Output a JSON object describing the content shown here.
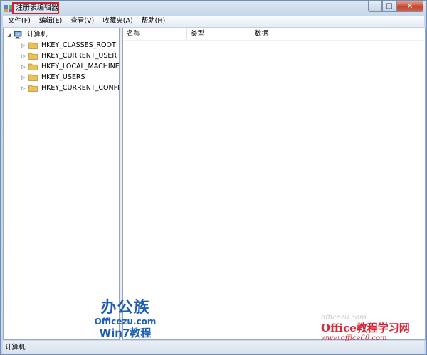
{
  "window": {
    "title": "注册表编辑器",
    "caption_buttons": {
      "minimize": "–",
      "maximize": "□",
      "close": "✕"
    }
  },
  "menu": {
    "items": [
      "文件(F)",
      "编辑(E)",
      "查看(V)",
      "收藏夹(A)",
      "帮助(H)"
    ]
  },
  "tree": {
    "root": {
      "label": "计算机",
      "expander": "◢",
      "icon": "computer-icon"
    },
    "children": [
      {
        "label": "HKEY_CLASSES_ROOT",
        "expander": "▷",
        "icon": "folder-icon"
      },
      {
        "label": "HKEY_CURRENT_USER",
        "expander": "▷",
        "icon": "folder-icon"
      },
      {
        "label": "HKEY_LOCAL_MACHINE",
        "expander": "▷",
        "icon": "folder-icon"
      },
      {
        "label": "HKEY_USERS",
        "expander": "▷",
        "icon": "folder-icon"
      },
      {
        "label": "HKEY_CURRENT_CONFIG",
        "expander": "▷",
        "icon": "folder-icon"
      }
    ]
  },
  "list": {
    "columns": [
      "名称",
      "类型",
      "数据"
    ]
  },
  "status": {
    "text": "计算机"
  },
  "watermarks": {
    "left": {
      "brand": "办公族",
      "site": "Officezu.com",
      "sub": "Win7教程"
    },
    "right": {
      "faint": "officezu.com",
      "main": "Office教程学习网",
      "url": "www.office68.com"
    }
  },
  "colors": {
    "highlight_box": "#d4202c",
    "folder": "#e8c15a",
    "watermark_blue": "#1f5fb3",
    "watermark_red": "#d4283a"
  }
}
